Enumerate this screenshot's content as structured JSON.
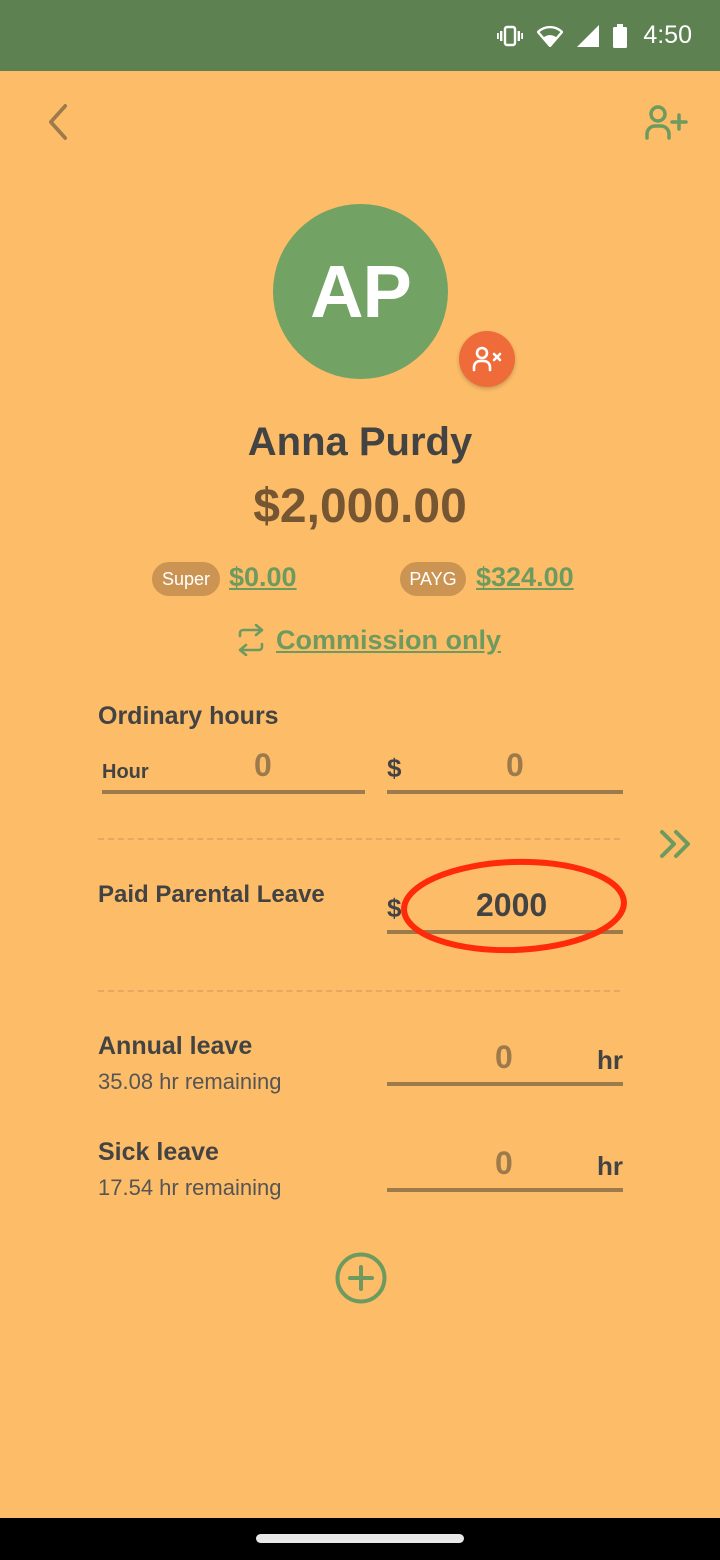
{
  "status_bar": {
    "time": "4:50",
    "icons": [
      "vibrate-icon",
      "wifi-icon",
      "signal-icon",
      "battery-icon"
    ]
  },
  "header": {
    "back_icon": "chevron-left-icon",
    "add_user_icon": "user-plus-icon"
  },
  "profile": {
    "initials": "AP",
    "name": "Anna Purdy",
    "total": "$2,000.00",
    "remove_icon": "user-x-icon",
    "avatar_color": "#72A264",
    "remove_color": "#EF6C3A"
  },
  "summary": {
    "super_label": "Super",
    "super_value": "$0.00",
    "payg_label": "PAYG",
    "payg_value": "$324.00",
    "pay_type_label": "Commission only",
    "pay_type_icon": "swap-icon"
  },
  "ordinary_hours": {
    "title": "Ordinary hours",
    "hour_label": "Hour",
    "hour_value": "0",
    "amount_prefix": "$",
    "amount_value": "0"
  },
  "parental_leave": {
    "title": "Paid Parental Leave",
    "prefix": "$",
    "value": "2000",
    "expand_icon": "double-chevron-right-icon",
    "annotation": "red-ellipse-highlight"
  },
  "annual_leave": {
    "title": "Annual leave",
    "remaining": "35.08 hr remaining",
    "value": "0",
    "unit": "hr"
  },
  "sick_leave": {
    "title": "Sick leave",
    "remaining": "17.54 hr remaining",
    "value": "0",
    "unit": "hr"
  },
  "add_icon": "plus-circle-icon",
  "colors": {
    "background": "#FDBD68",
    "status_bar": "#5E8152",
    "accent_green": "#6D9A5E",
    "brown": "#9C7A4C",
    "pill": "#CB9453",
    "annotation_red": "#FF2A0A"
  }
}
